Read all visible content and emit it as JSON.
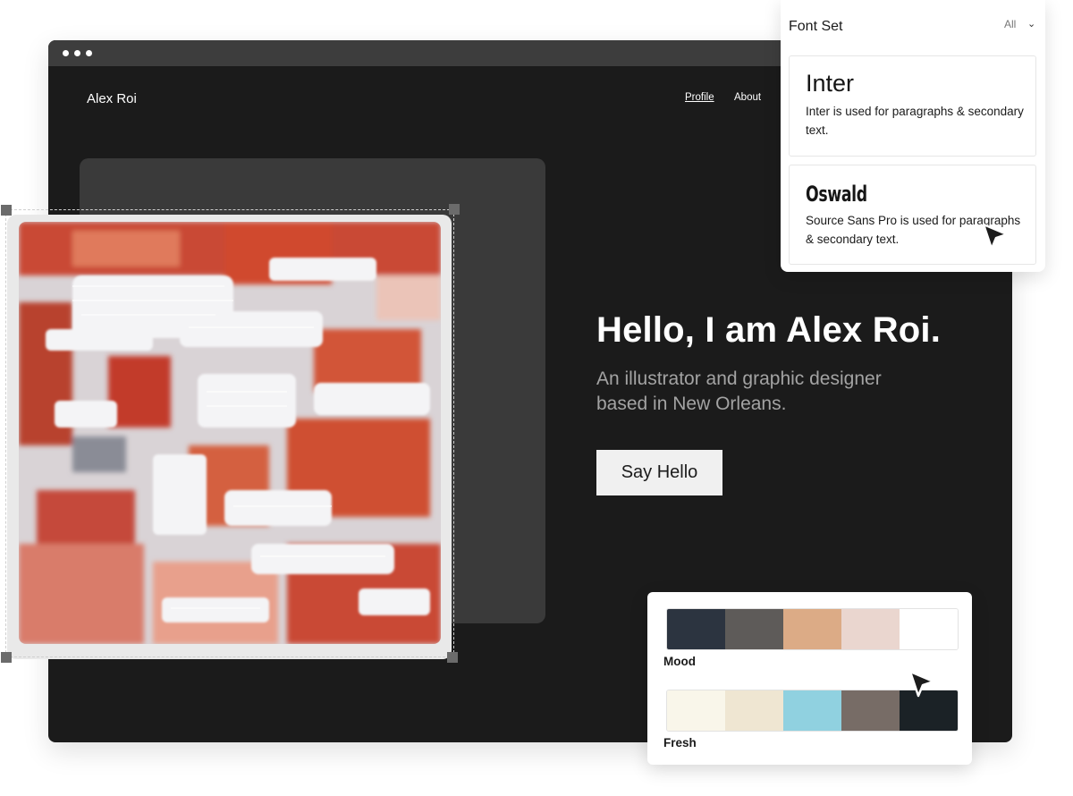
{
  "site": {
    "logo": "Alex Roi",
    "nav": [
      {
        "label": "Profile",
        "active": true
      },
      {
        "label": "About",
        "active": false
      }
    ],
    "hero_title": "Hello, I am Alex Roi.",
    "hero_subtitle": "An illustrator and graphic designer based in New Orleans.",
    "cta_label": "Say Hello"
  },
  "font_panel": {
    "title": "Font Set",
    "filter": "All",
    "options": [
      {
        "name": "Inter",
        "description": "Inter is used for paragraphs & secondary text."
      },
      {
        "name": "Oswald",
        "description": "Source Sans Pro is used for paragraphs & secondary text."
      }
    ]
  },
  "palettes": [
    {
      "name": "Mood",
      "colors": [
        "#2c3440",
        "#5e5b59",
        "#dcab86",
        "#ead6cf",
        "#ffffff"
      ]
    },
    {
      "name": "Fresh",
      "colors": [
        "#f9f6ea",
        "#efe6d2",
        "#90d1e0",
        "#776c66",
        "#1b2226"
      ]
    }
  ],
  "icons": {
    "window_controls": "dots-icon",
    "filter_chevron": "chevron-down-icon",
    "cursor": "cursor-arrow-icon"
  },
  "colors": {
    "background": "#1b1b1b",
    "panel": "#3a3a3a",
    "accent_light": "#f0f0f0"
  }
}
